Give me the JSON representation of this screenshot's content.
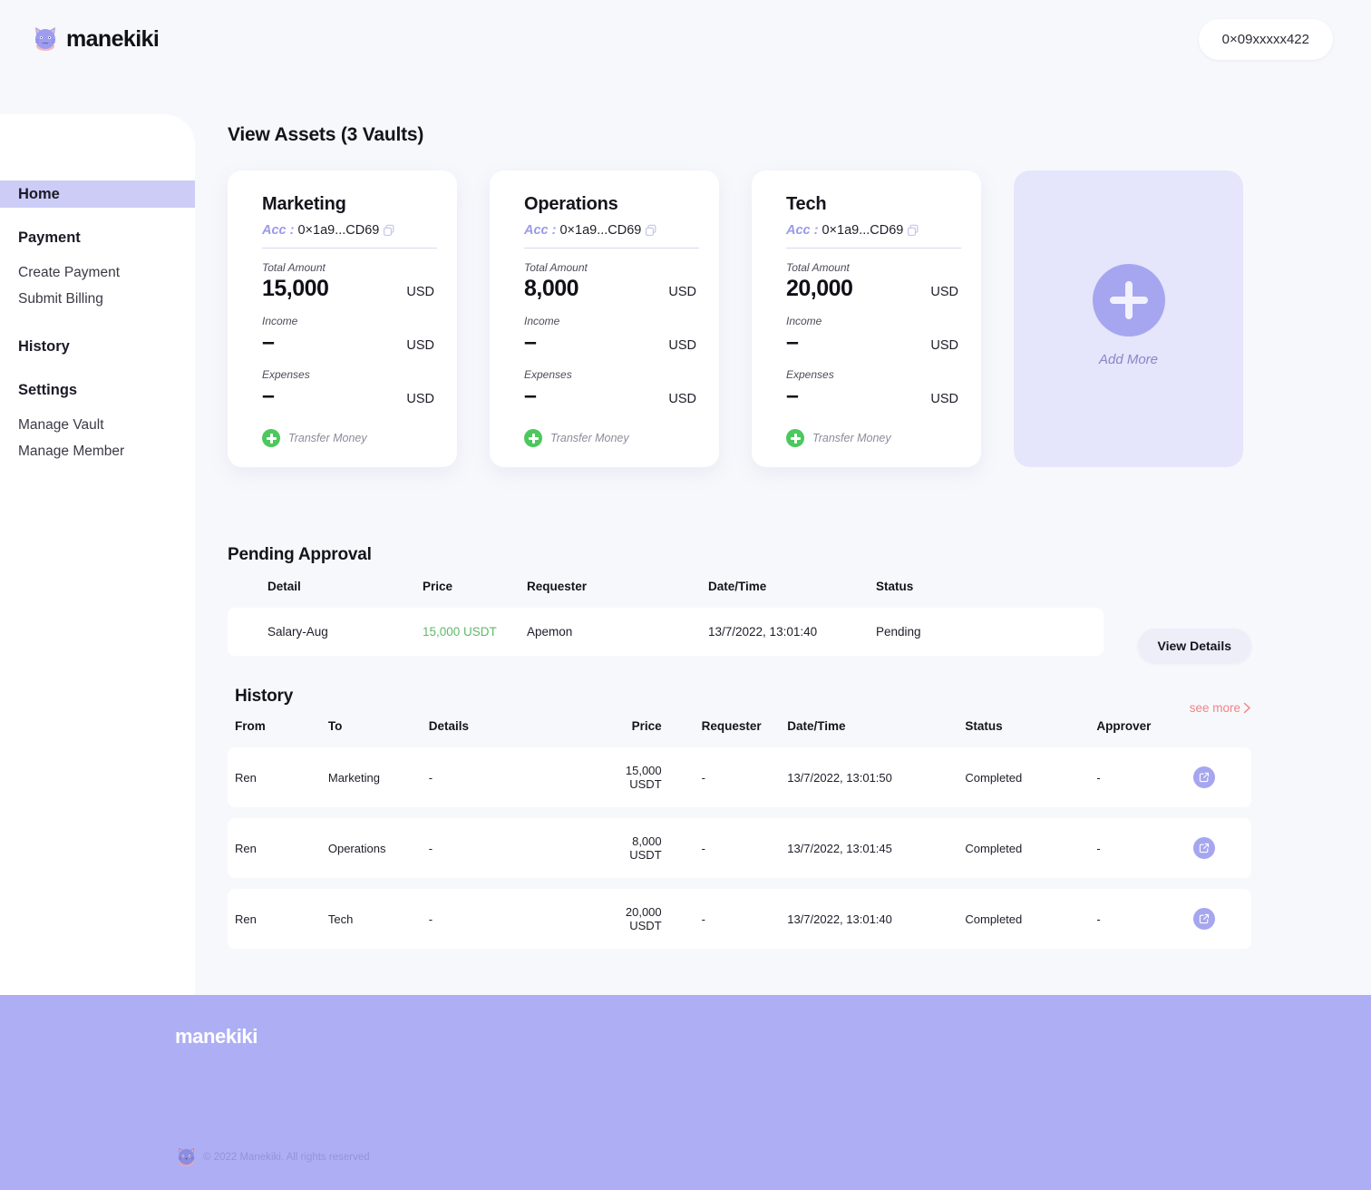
{
  "brand": {
    "name": "manekiki",
    "logo_icon": "cat-face-icon"
  },
  "topbar": {
    "wallet_address": "0×09xxxxx422"
  },
  "sidebar": {
    "items": [
      {
        "label": "Home",
        "type": "section",
        "active": true
      },
      {
        "label": "Payment",
        "type": "section",
        "active": false
      },
      {
        "label": "Create Payment",
        "type": "sub",
        "active": false
      },
      {
        "label": "Submit Billing",
        "type": "sub",
        "active": false
      },
      {
        "label": "History",
        "type": "section",
        "active": false
      },
      {
        "label": "Settings",
        "type": "section",
        "active": false
      },
      {
        "label": "Manage Vault",
        "type": "sub",
        "active": false
      },
      {
        "label": "Manage Member",
        "type": "sub",
        "active": false
      }
    ]
  },
  "main": {
    "page_title": "View Assets (3 Vaults)",
    "vaults": [
      {
        "name": "Marketing",
        "acc_key": "Acc :",
        "acc_value": "0×1a9...CD69",
        "copy_icon": "copy-icon",
        "total_label": "Total Amount",
        "total_value": "15,000",
        "total_currency": "USD",
        "income_label": "Income",
        "income_value": "–",
        "income_currency": "USD",
        "expenses_label": "Expenses",
        "expenses_value": "–",
        "expenses_currency": "USD",
        "transfer_label": "Transfer Money",
        "transfer_icon": "plus-circle-icon"
      },
      {
        "name": "Operations",
        "acc_key": "Acc :",
        "acc_value": "0×1a9...CD69",
        "copy_icon": "copy-icon",
        "total_label": "Total Amount",
        "total_value": "8,000",
        "total_currency": "USD",
        "income_label": "Income",
        "income_value": "–",
        "income_currency": "USD",
        "expenses_label": "Expenses",
        "expenses_value": "–",
        "expenses_currency": "USD",
        "transfer_label": "Transfer Money",
        "transfer_icon": "plus-circle-icon"
      },
      {
        "name": "Tech",
        "acc_key": "Acc :",
        "acc_value": "0×1a9...CD69",
        "copy_icon": "copy-icon",
        "total_label": "Total Amount",
        "total_value": "20,000",
        "total_currency": "USD",
        "income_label": "Income",
        "income_value": "–",
        "income_currency": "USD",
        "expenses_label": "Expenses",
        "expenses_value": "–",
        "expenses_currency": "USD",
        "transfer_label": "Transfer Money",
        "transfer_icon": "plus-circle-icon"
      }
    ],
    "add_more": {
      "label": "Add More",
      "icon": "plus-icon"
    },
    "pending": {
      "title": "Pending Approval",
      "columns": [
        "Detail",
        "Price",
        "Requester",
        "Date/Time",
        "Status"
      ],
      "rows": [
        {
          "detail": "Salary-Aug",
          "price": "15,000 USDT",
          "requester": "Apemon",
          "datetime": "13/7/2022, 13:01:40",
          "status": "Pending"
        }
      ],
      "view_details_label": "View Details"
    },
    "history": {
      "title": "History",
      "see_more_label": "see more",
      "see_more_icon": "chevron-right-icon",
      "columns": [
        "From",
        "To",
        "Details",
        "Price",
        "Requester",
        "Date/Time",
        "Status",
        "Approver"
      ],
      "rows": [
        {
          "from": "Ren",
          "to": "Marketing",
          "details": "-",
          "price": "15,000 USDT",
          "requester": "-",
          "datetime": "13/7/2022, 13:01:50",
          "status": "Completed",
          "approver": "-",
          "action_icon": "external-link-icon"
        },
        {
          "from": "Ren",
          "to": "Operations",
          "details": "-",
          "price": "8,000 USDT",
          "requester": "-",
          "datetime": "13/7/2022, 13:01:45",
          "status": "Completed",
          "approver": "-",
          "action_icon": "external-link-icon"
        },
        {
          "from": "Ren",
          "to": "Tech",
          "details": "-",
          "price": "20,000 USDT",
          "requester": "-",
          "datetime": "13/7/2022, 13:01:40",
          "status": "Completed",
          "approver": "-",
          "action_icon": "external-link-icon"
        }
      ]
    }
  },
  "footer": {
    "brand": "manekiki",
    "copyright": "© 2022 Manekiki. All rights reserved",
    "logo_icon": "cat-face-icon"
  },
  "colors": {
    "page_bg": "#f7f8fc",
    "accent_purple": "#a6a6f0",
    "footer_purple": "#aeaef5",
    "nav_active": "#ccccf7",
    "green": "#5fb96a",
    "salmon": "#f08585"
  }
}
